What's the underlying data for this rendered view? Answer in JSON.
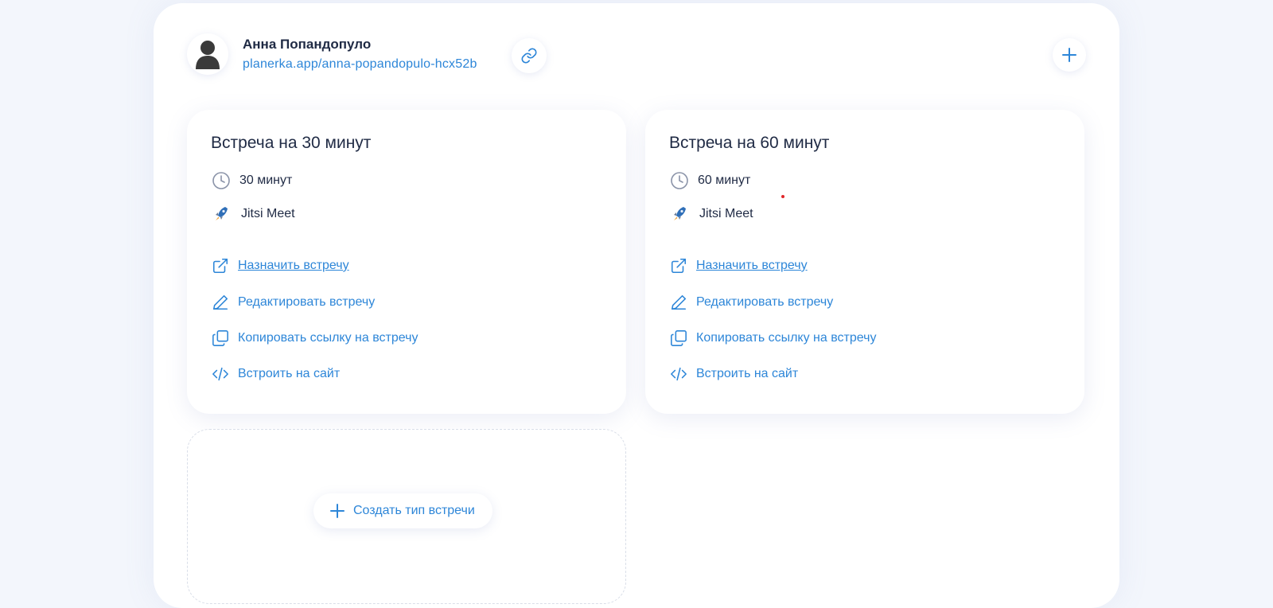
{
  "profile": {
    "name": "Анна Попандопуло",
    "url": "planerka.app/anna-popandopulo-hcx52b"
  },
  "meetings": [
    {
      "title": "Встреча на 30 минут",
      "duration": "30 минут",
      "platform": "Jitsi Meet",
      "actions": {
        "schedule": "Назначить встречу",
        "edit": "Редактировать встречу",
        "copy_link": "Копировать ссылку на встречу",
        "embed": "Встроить на сайт"
      }
    },
    {
      "title": "Встреча на 60 минут",
      "duration": "60 минут",
      "platform": "Jitsi Meet",
      "actions": {
        "schedule": "Назначить встречу",
        "edit": "Редактировать встречу",
        "copy_link": "Копировать ссылку на встречу",
        "embed": "Встроить на сайт"
      }
    }
  ],
  "create": {
    "label": "Создать тип встречи"
  },
  "colors": {
    "accent": "#2d86d8",
    "text": "#1f2a44",
    "background": "#f3f6fc"
  }
}
